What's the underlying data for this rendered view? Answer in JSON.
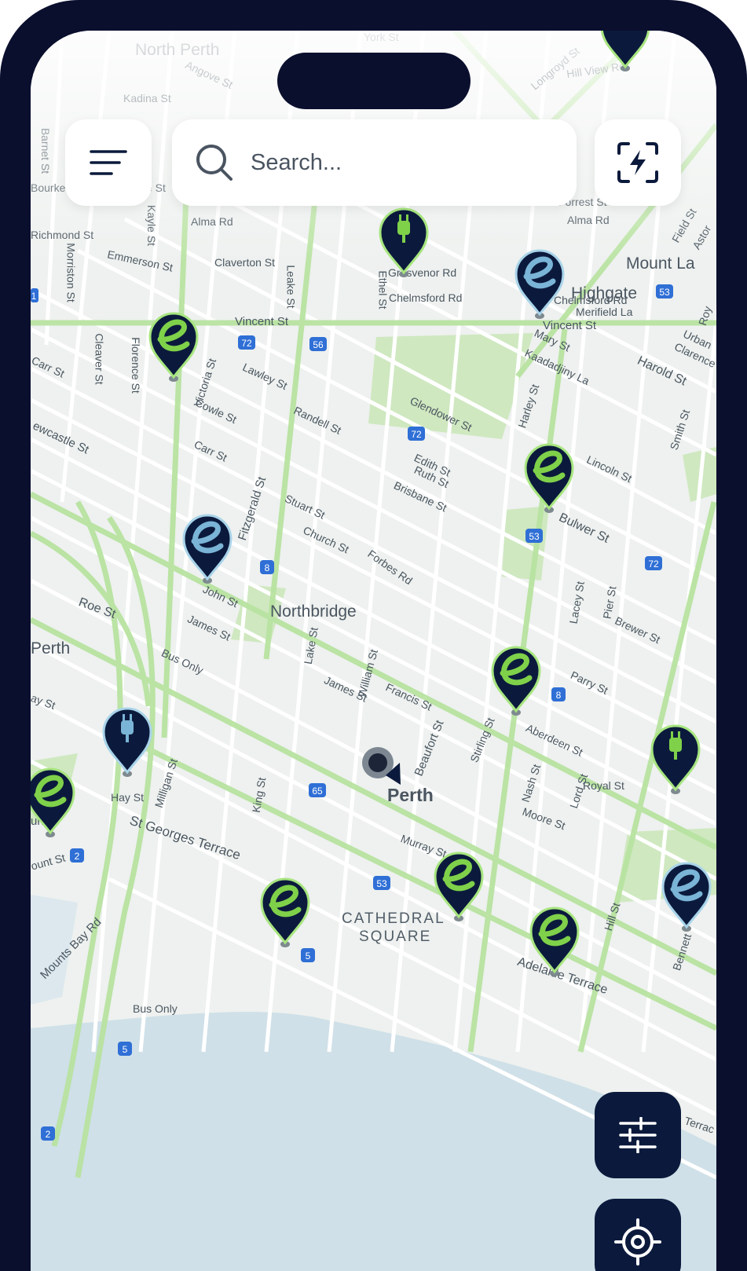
{
  "search": {
    "placeholder": "Search..."
  },
  "map": {
    "places": {
      "north_perth": "North Perth",
      "highgate": "Highgate",
      "mount_lawley": "Mount La",
      "northbridge": "Northbridge",
      "perth": "Perth",
      "perth_west": "Perth",
      "cathedral_1": "CATHEDRAL",
      "cathedral_2": "SQUARE"
    },
    "streets": {
      "angove": "Angove St",
      "kadina": "Kadina St",
      "alma_w": "Alma Rd",
      "alma_e": "Alma Rd",
      "richmond": "Richmond St",
      "emmerson": "Emmerson St",
      "claverton": "Claverton St",
      "grosvenor": "Grosvenor Rd",
      "chelmsford_w": "Chelmsford Rd",
      "chelmsford_e": "Chelmsford Rd",
      "merifield": "Merifield La",
      "vincent_w": "Vincent St",
      "vincent_e": "Vincent St",
      "forrest_w": "Forrest St",
      "forrest_e": "Forrest St",
      "longroyd": "Longroyd St",
      "hill_view": "Hill View Rd",
      "bourke": "Bourke",
      "carr_w": "Carr St",
      "carr": "Carr St",
      "lawley": "Lawley St",
      "cowle": "Cowle St",
      "randell": "Randell St",
      "glendower": "Glendower St",
      "newcastle": "ewcastle St",
      "mary": "Mary St",
      "kaadadjiny": "Kaadadjiny La",
      "harold": "Harold St",
      "lincoln": "Lincoln St",
      "bulwer": "Bulwer St",
      "edith": "Edith St",
      "ruth": "Ruth St",
      "brisbane": "Brisbane St",
      "stuart": "Stuart St",
      "church": "Church St",
      "forbes": "Forbes Rd",
      "john": "John St",
      "roe": "Roe St",
      "james_w": "James St",
      "james": "James St",
      "bus_only": "Bus Only",
      "francis": "Francis St",
      "parry": "Parry St",
      "brewer": "Brewer St",
      "aberdeen": "Aberdeen St",
      "royal": "Royal St",
      "moore": "Moore St",
      "st_georges": "St Georges Terrace",
      "murray": "Murray St",
      "adelaide": "Adelaide Terrace",
      "mounts_bay": "Mounts Bay Rd",
      "bus_only_2": "Bus Only",
      "william": "William St",
      "beaufort": "Beaufort St",
      "stirling": "Stirling St",
      "fitzgerald": "Fitzgerald St",
      "milligan": "Milligan St",
      "lord": "Lord St",
      "hay": "Hay St",
      "hill": "Hill St",
      "lacey": "Lacey St",
      "pier": "Pier St",
      "nash": "Nash St",
      "smith": "Smith St",
      "bennett": "Bennett",
      "king": "King St",
      "lake": "Lake St",
      "leake": "Leake St",
      "ethel": "Ethel St",
      "cleaver": "Cleaver St",
      "florence": "Florence St",
      "victoria": "Victoria St",
      "harley": "Harley St",
      "kayle": "Kayle St",
      "morriston": "Morriston St",
      "barnet": "Barnet St",
      "hay_w": "ay St",
      "un_st": "un St",
      "ount_st": "ount St",
      "york": "York St",
      "urban": "Urban",
      "clarence": "Clarence",
      "astor": "Astor",
      "field": "Field St",
      "terrace_e": "Terrac",
      "le_st": "ke St",
      "bent": "Roy"
    },
    "shields": {
      "s72a": "72",
      "s56": "56",
      "s72b": "72",
      "s53a": "53",
      "s53b": "53",
      "s72c": "72",
      "s8a": "8",
      "s8b": "8",
      "s65": "65",
      "s53c": "53",
      "s5a": "5",
      "s5b": "5",
      "s2a": "2",
      "s2b": "2",
      "s1": "1"
    },
    "colors": {
      "pin_dark": "#0b1a3c",
      "accent_green": "#7fd14a",
      "accent_blue": "#7ab4d6"
    }
  }
}
